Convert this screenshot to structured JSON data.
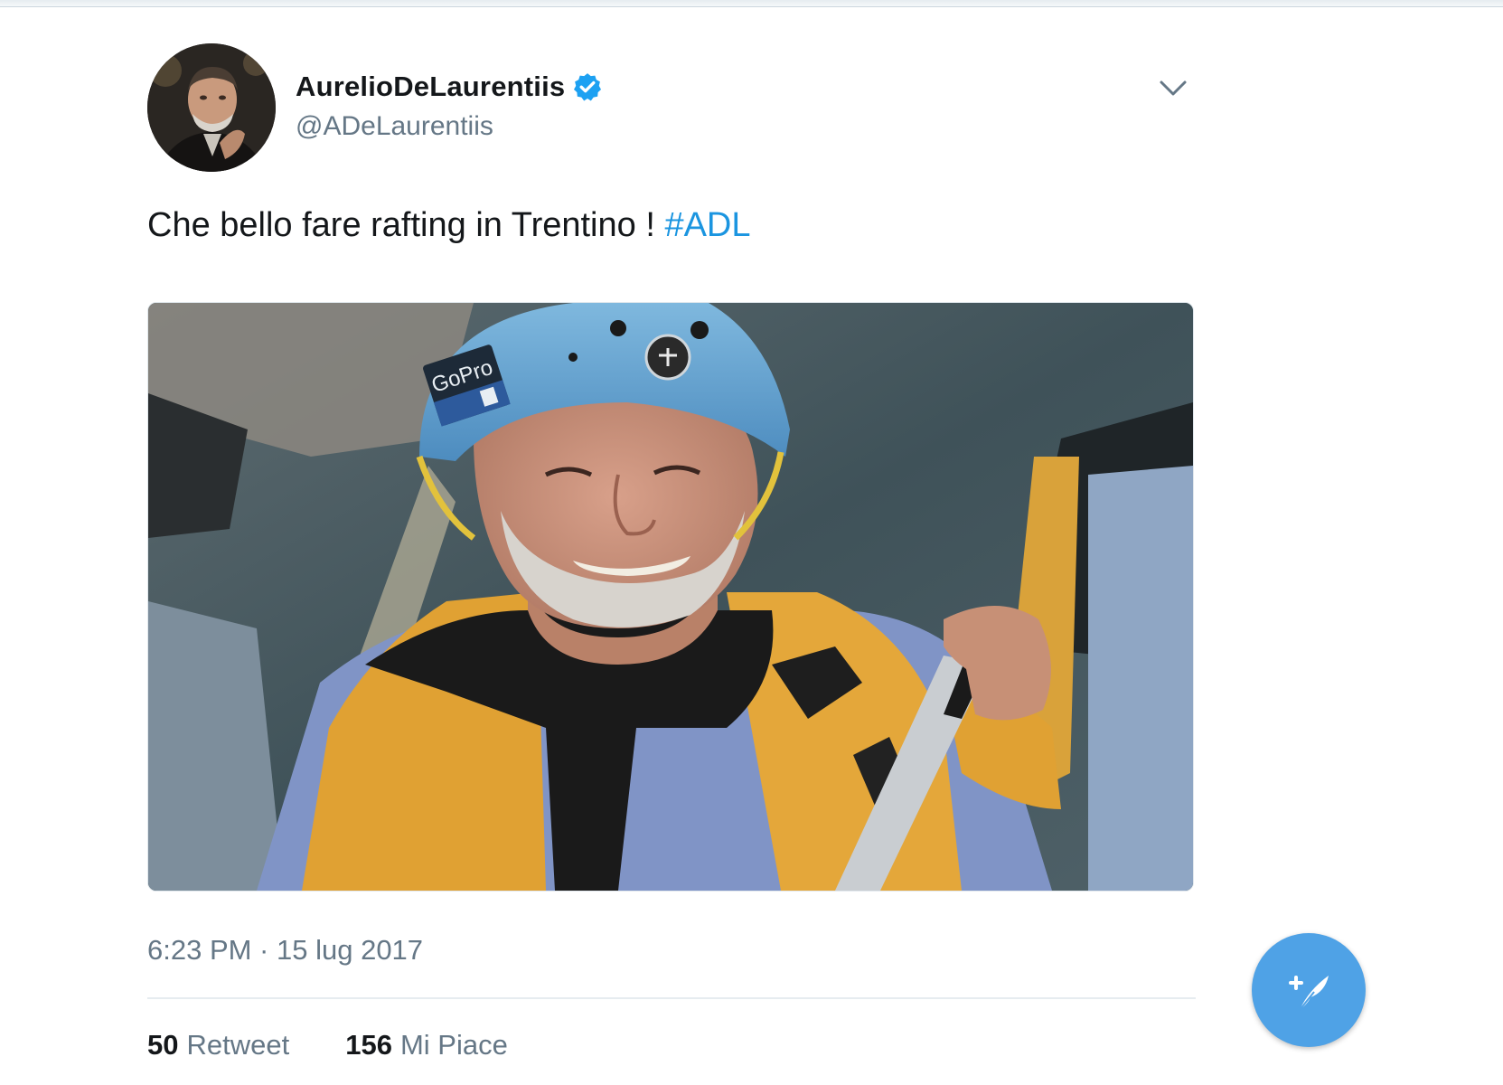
{
  "tweet": {
    "author_name": "AurelioDeLaurentiis",
    "author_handle": "@ADeLaurentiis",
    "verified": true,
    "text": "Che bello fare rafting in Trentino !",
    "hashtag": "#ADL",
    "timestamp": "6:23 PM · 15 lug 2017",
    "retweet_count": "50",
    "retweet_label": "Retweet",
    "like_count": "156",
    "like_label": "Mi Piace"
  },
  "media": {
    "helmet_brand": "GoPro"
  },
  "icons": {
    "verified": "verified-badge-icon",
    "caret": "chevron-down-icon",
    "compose": "compose-tweet-icon"
  },
  "colors": {
    "link": "#1b95e0",
    "verified": "#1da1f2",
    "fab": "#4fa2e6",
    "muted_text": "#657786"
  }
}
